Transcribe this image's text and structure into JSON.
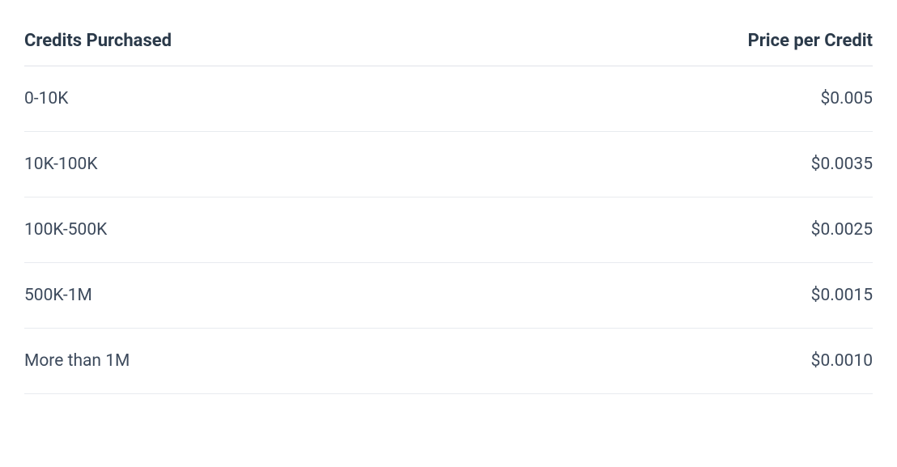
{
  "table": {
    "headers": {
      "credits": "Credits Purchased",
      "price": "Price per Credit"
    },
    "rows": [
      {
        "credits": "0-10K",
        "price": "$0.005"
      },
      {
        "credits": "10K-100K",
        "price": "$0.0035"
      },
      {
        "credits": "100K-500K",
        "price": "$0.0025"
      },
      {
        "credits": "500K-1M",
        "price": "$0.0015"
      },
      {
        "credits": "More than 1M",
        "price": "$0.0010"
      }
    ]
  }
}
